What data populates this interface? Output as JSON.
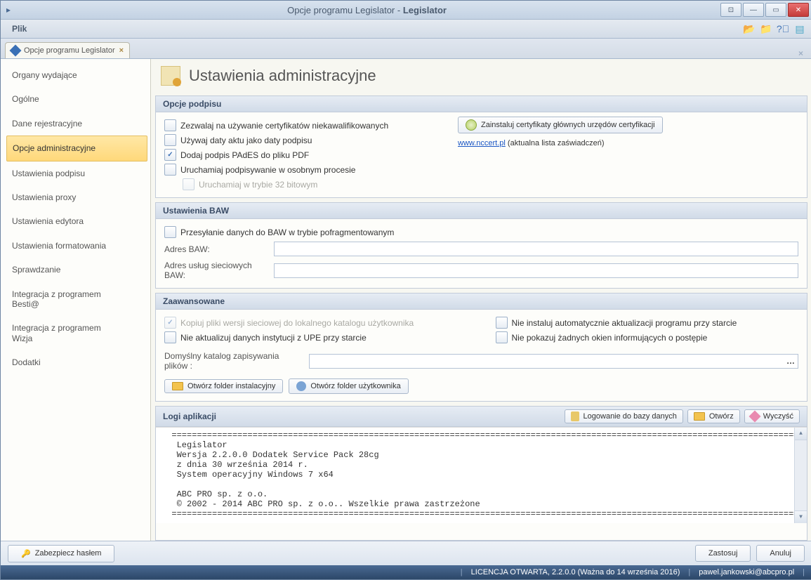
{
  "window": {
    "title_light": "Opcje programu Legislator - ",
    "title_bold": "Legislator"
  },
  "menubar": {
    "file": "Plik"
  },
  "tab": {
    "label": "Opcje programu Legislator"
  },
  "sidebar": {
    "items": [
      {
        "label": "Organy wydające"
      },
      {
        "label": "Ogólne"
      },
      {
        "label": "Dane rejestracyjne"
      },
      {
        "label": "Opcje administracyjne"
      },
      {
        "label": "Ustawienia podpisu"
      },
      {
        "label": "Ustawienia proxy"
      },
      {
        "label": "Ustawienia edytora"
      },
      {
        "label": "Ustawienia formatowania"
      },
      {
        "label": "Sprawdzanie"
      },
      {
        "label": "Integracja z programem Besti@"
      },
      {
        "label": "Integracja z programem Wizja"
      },
      {
        "label": "Dodatki"
      }
    ]
  },
  "page": {
    "title": "Ustawienia administracyjne"
  },
  "sections": {
    "sig": {
      "title": "Opcje podpisu",
      "cb1": "Zezwalaj na używanie certyfikatów niekawalifikowanych",
      "cb2": "Używaj daty aktu jako daty podpisu",
      "cb3": "Dodaj podpis PAdES do pliku PDF",
      "cb4": "Uruchamiaj podpisywanie w osobnym procesie",
      "cb5": "Uruchamiaj w trybie 32 bitowym",
      "btn": "Zainstaluj certyfikaty głównych urzędów certyfikacji",
      "link": "www.nccert.pl",
      "link_suffix": " (aktualna lista zaświadczeń)"
    },
    "baw": {
      "title": "Ustawienia BAW",
      "cb1": "Przesyłanie danych do BAW w trybie pofragmentowanym",
      "f1": "Adres BAW:",
      "f2": "Adres usług sieciowych BAW:"
    },
    "adv": {
      "title": "Zaawansowane",
      "cb1": "Kopiuj pliki wersji sieciowej do lokalnego katalogu użytkownika",
      "cb2": "Nie instaluj automatycznie aktualizacji programu przy starcie",
      "cb3": "Nie aktualizuj danych instytucji z UPE przy starcie",
      "cb4": "Nie pokazuj żadnych okien informujących o postępie",
      "path_label": "Domyślny katalog zapisywania plików :",
      "btn1": "Otwórz folder instalacyjny",
      "btn2": "Otwórz folder użytkownika"
    },
    "log": {
      "title": "Logi aplikacji",
      "btn_db": "Logowanie do bazy danych",
      "btn_open": "Otwórz",
      "btn_clear": "Wyczyść",
      "text": "  ===============================================================================================================================\n   Legislator\n   Wersja 2.2.0.0 Dodatek Service Pack 28cg\n   z dnia 30 września 2014 r.\n   System operacyjny Windows 7 x64\n\n   ABC PRO sp. z o.o.\n   © 2002 - 2014 ABC PRO sp. z o.o.. Wszelkie prawa zastrzeżone\n  ==============================================================================================================================="
    }
  },
  "footer": {
    "secure": "Zabezpiecz hasłem",
    "apply": "Zastosuj",
    "cancel": "Anuluj"
  },
  "status": {
    "license": "LICENCJA OTWARTA, 2.2.0.0 (Ważna do 14 września 2016)",
    "email": "pawel.jankowski@abcpro.pl"
  }
}
